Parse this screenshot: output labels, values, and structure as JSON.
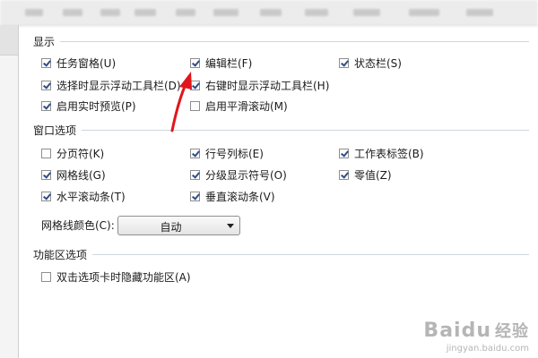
{
  "sections": {
    "display": {
      "title": "显示",
      "options": {
        "task_pane": {
          "label": "任务窗格(U)",
          "checked": true
        },
        "edit_bar": {
          "label": "编辑栏(F)",
          "checked": true
        },
        "status_bar": {
          "label": "状态栏(S)",
          "checked": true
        },
        "float_toolbar_on_select": {
          "label": "选择时显示浮动工具栏(D)",
          "checked": true
        },
        "float_toolbar_on_right_click": {
          "label": "右键时显示浮动工具栏(H)",
          "checked": true
        },
        "live_preview": {
          "label": "启用实时预览(P)",
          "checked": true
        },
        "smooth_scroll": {
          "label": "启用平滑滚动(M)",
          "checked": false
        }
      }
    },
    "window": {
      "title": "窗口选项",
      "options": {
        "page_break": {
          "label": "分页符(K)",
          "checked": false
        },
        "row_col_headers": {
          "label": "行号列标(E)",
          "checked": true
        },
        "sheet_tabs": {
          "label": "工作表标签(B)",
          "checked": true
        },
        "gridlines": {
          "label": "网格线(G)",
          "checked": true
        },
        "outline_symbols": {
          "label": "分级显示符号(O)",
          "checked": true
        },
        "zero_values": {
          "label": "零值(Z)",
          "checked": true
        },
        "h_scrollbar": {
          "label": "水平滚动条(T)",
          "checked": true
        },
        "v_scrollbar": {
          "label": "垂直滚动条(V)",
          "checked": true
        }
      },
      "gridline_color": {
        "label": "网格线颜色(C):",
        "value": "自动"
      }
    },
    "ribbon": {
      "title": "功能区选项",
      "options": {
        "dblclick_hide_ribbon": {
          "label": "双击选项卡时隐藏功能区(A)",
          "checked": false
        }
      }
    }
  },
  "colors": {
    "annotation_arrow": "#e0161b",
    "check_mark": "#2f4e88"
  },
  "watermark": {
    "brand": "Baidu",
    "brand_cn": "经验",
    "url": "jingyan.baidu.com"
  }
}
